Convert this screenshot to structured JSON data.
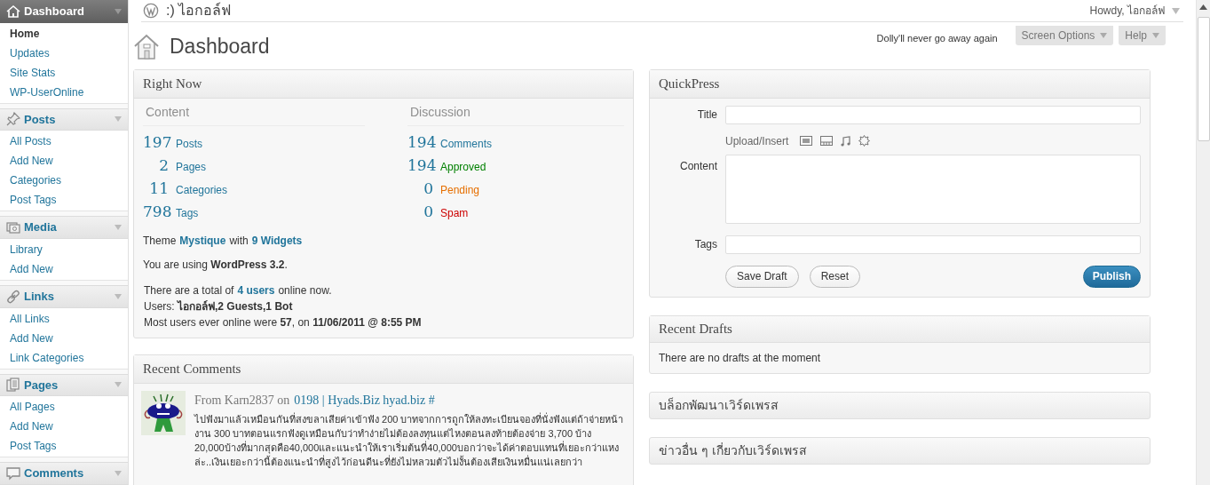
{
  "admin_bar": {
    "site_title": ":) ไอกอล์ฟ",
    "greeting": "Howdy, ไอกอล์ฟ"
  },
  "sidebar": {
    "menus": [
      {
        "label": "Dashboard",
        "selected": true,
        "items": [
          {
            "label": "Home",
            "selected": true
          },
          {
            "label": "Updates",
            "selected": false
          },
          {
            "label": "Site Stats",
            "selected": false
          },
          {
            "label": "WP-UserOnline",
            "selected": false
          }
        ]
      },
      {
        "label": "Posts",
        "selected": false,
        "items": [
          {
            "label": "All Posts",
            "selected": false
          },
          {
            "label": "Add New",
            "selected": false
          },
          {
            "label": "Categories",
            "selected": false
          },
          {
            "label": "Post Tags",
            "selected": false
          }
        ]
      },
      {
        "label": "Media",
        "selected": false,
        "items": [
          {
            "label": "Library",
            "selected": false
          },
          {
            "label": "Add New",
            "selected": false
          }
        ]
      },
      {
        "label": "Links",
        "selected": false,
        "items": [
          {
            "label": "All Links",
            "selected": false
          },
          {
            "label": "Add New",
            "selected": false
          },
          {
            "label": "Link Categories",
            "selected": false
          }
        ]
      },
      {
        "label": "Pages",
        "selected": false,
        "items": [
          {
            "label": "All Pages",
            "selected": false
          },
          {
            "label": "Add New",
            "selected": false
          },
          {
            "label": "Post Tags",
            "selected": false
          }
        ]
      },
      {
        "label": "Comments",
        "selected": false
      }
    ]
  },
  "page": {
    "title": "Dashboard",
    "dolly": "Dolly'll never go away again",
    "buttons": [
      "Screen Options",
      "Help"
    ]
  },
  "right_now": {
    "title": "Right Now",
    "content": {
      "heading": "Content",
      "rows": [
        {
          "count": "197",
          "label": "Posts"
        },
        {
          "count": "2",
          "label": "Pages"
        },
        {
          "count": "11",
          "label": "Categories"
        },
        {
          "count": "798",
          "label": "Tags"
        }
      ]
    },
    "discussion": {
      "heading": "Discussion",
      "rows": [
        {
          "count": "194",
          "label": "Comments",
          "color": "#21759b"
        },
        {
          "count": "194",
          "label": "Approved",
          "color": "#008000"
        },
        {
          "count": "0",
          "label": "Pending",
          "color": "#e66f00"
        },
        {
          "count": "0",
          "label": "Spam",
          "color": "#cc0000"
        }
      ]
    },
    "theme_line": {
      "prefix": "Theme",
      "theme": "Mystique",
      "middle": "with",
      "widgets": "9 Widgets"
    },
    "version": "You are using **WordPress 3.2**.",
    "online": {
      "prefix": "There are a total of",
      "link": "4 users",
      "suffix": "online now."
    },
    "users": "Users: **ไอกอล์ฟ,2 Guests,1 Bot**",
    "most": "Most users ever online were **57**, on **11/06/2011 @ 8:55 PM**"
  },
  "recent_comments": {
    "title": "Recent Comments",
    "comments": [
      {
        "from": "From Karn2837 on",
        "post": "0198 | Hyads.Biz hyad.biz #",
        "text": "ไปฟังมาแล้วเหมือนกันที่สงขลาเสียค่าเข้าฟัง 200 บาทจากการถูกให้ลงทะเบียนจองที่นั่งฟังแต่ถ้าจ่ายหน้างาน 300 บาทตอนแรกฟังดูเหมือนกับว่าทำง่ายไม่ต้องลงทุนแต่ไหงตอนลงท้ายต้องจ่าย 3,700 บ้าง 20,000บ้างที่มากสุดคือ40,000และแนะนำให้เราเริ่มต้นที่40,000บอกว่าจะได้ค่าตอบแทนที่เยอะกว่าแหงล่ะ..เงินเยอะกว่านี้ต้องแนะนำที่สูงไว้ก่อนดีนะที่ยังไม่หลวมตัวไม่งั้นต้องเสียเงินหมื่นแน่เลยกว่า"
      }
    ]
  },
  "quickpress": {
    "title": "QuickPress",
    "title_label": "Title",
    "upload_label": "Upload/Insert",
    "content_label": "Content",
    "tags_label": "Tags",
    "buttons": [
      {
        "label": "Save Draft",
        "kind": "secondary"
      },
      {
        "label": "Reset",
        "kind": "secondary"
      },
      {
        "label": "Publish",
        "kind": "primary"
      }
    ]
  },
  "recent_drafts": {
    "title": "Recent Drafts",
    "text": "There are no drafts at the moment"
  },
  "collapsed_boxes": [
    {
      "title": "บล็อกพัฒนาเวิร์ดเพรส"
    },
    {
      "title": "ข่าวอื่น ๆ เกี่ยวกับเวิร์ดเพรส"
    }
  ]
}
